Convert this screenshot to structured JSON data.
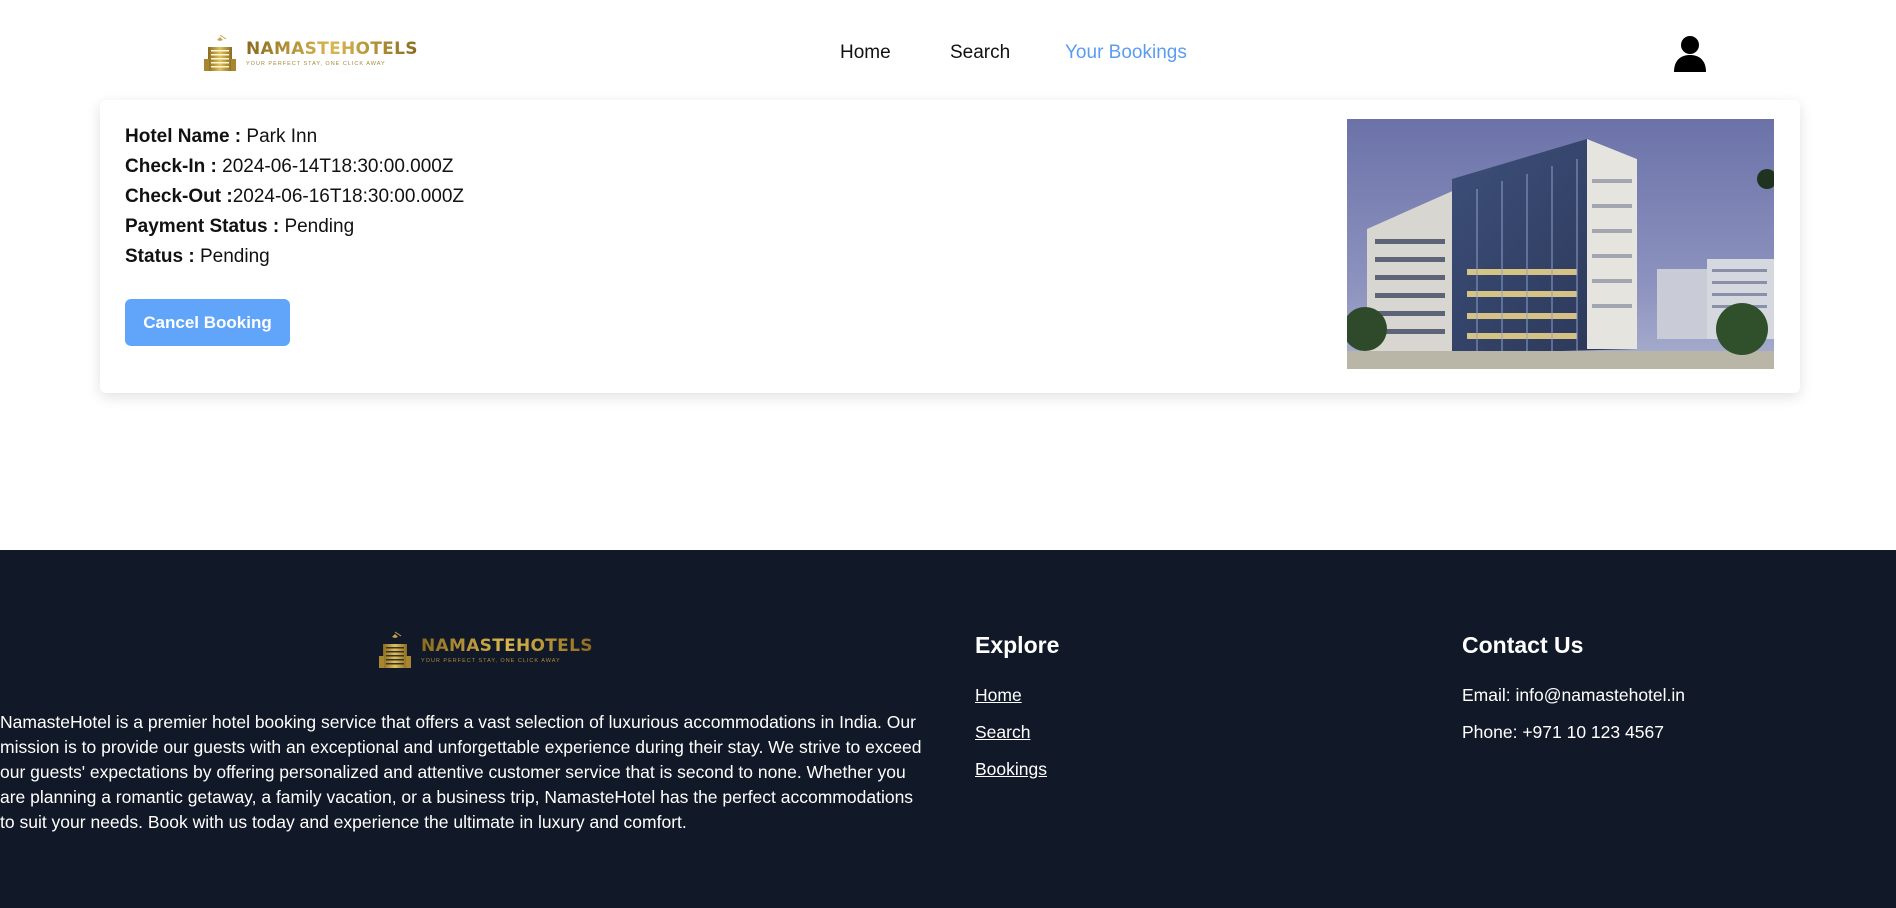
{
  "header": {
    "logo": {
      "brand": "NAMASTEHOTELS",
      "tagline": "YOUR PERFECT STAY, ONE CLICK AWAY"
    },
    "nav": {
      "home": "Home",
      "search": "Search",
      "bookings": "Your Bookings"
    },
    "user_icon": "user-icon",
    "active_color": "#5b9cf2"
  },
  "booking": {
    "hotel_label": "Hotel Name :",
    "hotel_value": "Park Inn",
    "checkin_label": "Check-In :",
    "checkin_value": "2024-06-14T18:30:00.000Z",
    "checkout_label": "Check-Out :",
    "checkout_value": "2024-06-16T18:30:00.000Z",
    "payment_label": "Payment Status :",
    "payment_value": "Pending",
    "status_label": "Status :",
    "status_value": "Pending",
    "cancel_label": "Cancel Booking",
    "button_color": "#60a5fa"
  },
  "footer": {
    "logo": {
      "brand": "NAMASTEHOTELS",
      "tagline": "YOUR PERFECT STAY, ONE CLICK AWAY"
    },
    "about": "NamasteHotel is a premier hotel booking service that offers a vast selection of luxurious accommodations in India. Our mission is to provide our guests with an exceptional and unforgettable experience during their stay. We strive to exceed our guests' expectations by offering personalized and attentive customer service that is second to none. Whether you are planning a romantic getaway, a family vacation, or a business trip, NamasteHotel has the perfect accommodations to suit your needs. Book with us today and experience the ultimate in luxury and comfort.",
    "explore": {
      "title": "Explore",
      "home": "Home",
      "search": "Search",
      "bookings": "Bookings"
    },
    "contact": {
      "title": "Contact Us",
      "email": "Email: info@namastehotel.in",
      "phone": "Phone: +971 10 123 4567"
    },
    "background": "#111827"
  }
}
